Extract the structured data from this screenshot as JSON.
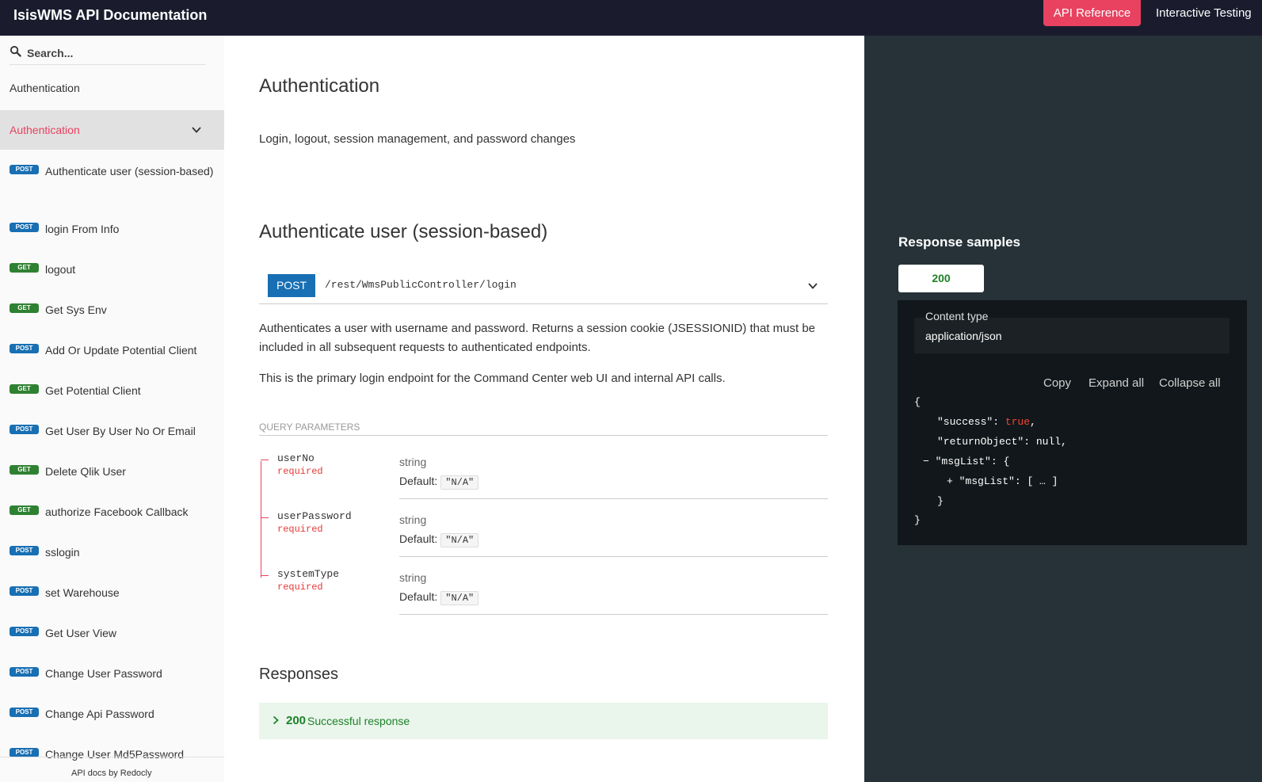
{
  "topbar": {
    "title": "IsisWMS API Documentation",
    "nav_api_reference": "API Reference",
    "nav_interactive_testing": "Interactive Testing",
    "accent": "#e84260"
  },
  "sidebar": {
    "search_placeholder": "Search...",
    "group_label": "Authentication",
    "active_group_label": "Authentication",
    "items": [
      {
        "method": "POST",
        "label": "Authenticate user (session-based)"
      },
      {
        "method": "POST",
        "label": "login From Info"
      },
      {
        "method": "GET",
        "label": "logout"
      },
      {
        "method": "GET",
        "label": "Get Sys Env"
      },
      {
        "method": "POST",
        "label": "Add Or Update Potential Client"
      },
      {
        "method": "GET",
        "label": "Get Potential Client"
      },
      {
        "method": "POST",
        "label": "Get User By User No Or Email"
      },
      {
        "method": "GET",
        "label": "Delete Qlik User"
      },
      {
        "method": "GET",
        "label": "authorize Facebook Callback"
      },
      {
        "method": "POST",
        "label": "sslogin"
      },
      {
        "method": "POST",
        "label": "set Warehouse"
      },
      {
        "method": "POST",
        "label": "Get User View"
      },
      {
        "method": "POST",
        "label": "Change User Password"
      },
      {
        "method": "POST",
        "label": "Change Api Password"
      },
      {
        "method": "POST",
        "label": "Change User Md5Password"
      }
    ],
    "footer_text": "API docs by Redocly"
  },
  "content": {
    "group_title": "Authentication",
    "group_description": "Login, logout, session management, and password changes",
    "operation_title": "Authenticate user (session-based)",
    "method": "POST",
    "path": "/rest/WmsPublicController/login",
    "description_1": "Authenticates a user with username and password. Returns a session cookie (JSESSIONID) that must be included in all subsequent requests to authenticated endpoints.",
    "description_2": "This is the primary login endpoint for the Command Center web UI and internal API calls.",
    "params_title": "QUERY PARAMETERS",
    "params": [
      {
        "name": "userNo",
        "required": "required",
        "type": "string",
        "default_label": "Default:",
        "default_value": "\"N/A\""
      },
      {
        "name": "userPassword",
        "required": "required",
        "type": "string",
        "default_label": "Default:",
        "default_value": "\"N/A\""
      },
      {
        "name": "systemType",
        "required": "required",
        "type": "string",
        "default_label": "Default:",
        "default_value": "\"N/A\""
      }
    ],
    "responses_title": "Responses",
    "response_code": "200",
    "response_label": "Successful response"
  },
  "samples": {
    "title": "Response samples",
    "tab": "200",
    "content_type_label": "Content type",
    "content_type_value": "application/json",
    "copy": "Copy",
    "expand_all": "Expand all",
    "collapse_all": "Collapse all",
    "json": {
      "open": "{",
      "success_key": "\"success\"",
      "success_val": "true",
      "return_key": "\"returnObject\"",
      "return_val": "null",
      "msg_toggle": "−",
      "msg_key": "\"msgList\"",
      "msg_open": "{",
      "inner_toggle": "+",
      "inner_key": "\"msgList\"",
      "inner_val": "[ … ]",
      "inner_close": "}",
      "close": "}"
    }
  }
}
